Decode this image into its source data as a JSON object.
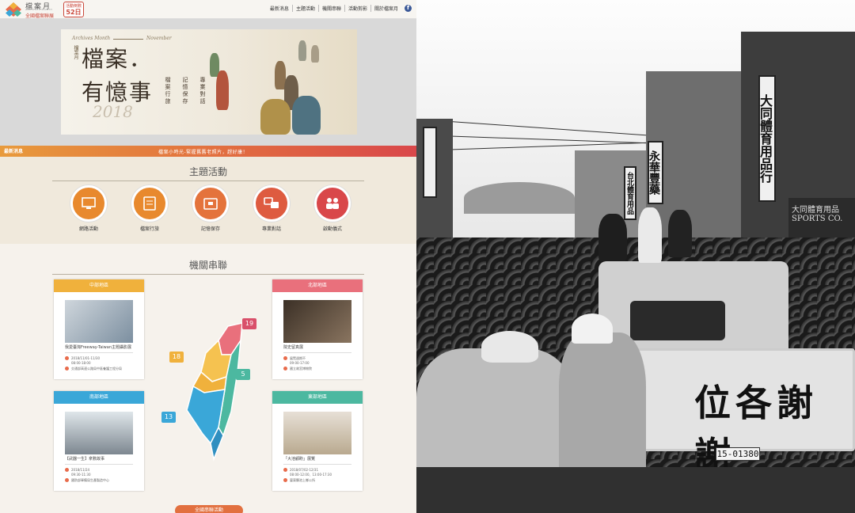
{
  "site": {
    "logo": {
      "name": "檔案月",
      "subtitle": "ARCHIVES MONTH",
      "org": "全國檔案聯展"
    },
    "countdown": {
      "label": "活動倒數",
      "value": "52日"
    },
    "nav": [
      "最新消息",
      "主題活動",
      "機關串聯",
      "活動剪影",
      "關於檔案月"
    ],
    "facebook_glyph": "f",
    "banner": {
      "english_left": "Archives Month",
      "english_right": "November",
      "side_label": "檔案月",
      "title_line1": "檔案．",
      "title_line2": "有憶事",
      "year": "2018",
      "vertical_texts": [
        "專業對話",
        "記憶保存",
        "檔案行旅"
      ],
      "carousel_dots": 4,
      "active_dot": 0
    },
    "news": {
      "label": "最新消息",
      "text": "檔案小時光-緊握舊舊老照片，趕好康！"
    },
    "activities": {
      "title": "主題活動",
      "items": [
        {
          "label": "網路活動",
          "icon": "computer-icon",
          "color": "#e8892e"
        },
        {
          "label": "檔案行旅",
          "icon": "book-icon",
          "color": "#e8892e"
        },
        {
          "label": "記憶保存",
          "icon": "archive-box-icon",
          "color": "#e4733c"
        },
        {
          "label": "專業對話",
          "icon": "chat-icon",
          "color": "#de5b40"
        },
        {
          "label": "啟動儀式",
          "icon": "people-icon",
          "color": "#d9474a"
        }
      ]
    },
    "partners": {
      "title": "機關串聯",
      "map_badges": [
        {
          "value": "19",
          "color": "#d9506a"
        },
        {
          "value": "18",
          "color": "#f0b13c"
        },
        {
          "value": "5",
          "color": "#4cb8a0"
        },
        {
          "value": "13",
          "color": "#3aa7d8"
        }
      ],
      "cards": [
        {
          "region": "中部地區",
          "color": "#f0b13c",
          "caption": "我愛臺灣Freeway-Taiwan主題攝影展",
          "date": "2018/11/01-11/30",
          "time": "08:00-18:00",
          "place": "交通部高速公路局中區養護工程分局"
        },
        {
          "region": "北部地區",
          "color": "#e9707c",
          "caption": "院史留真展",
          "date": "展覽週期不",
          "time": "09:00-17:00",
          "place": "國立故宮博物院"
        },
        {
          "region": "南部地區",
          "color": "#3aa7d8",
          "caption": "【武器一生】拿數故事",
          "date": "2018/11/24",
          "time": "09:30-11:30",
          "place": "國防部軍備局生產製造中心"
        },
        {
          "region": "東部地區",
          "color": "#4cb8a0",
          "caption": "「大池顧盼」展覽",
          "date": "2018/07/02-12/31",
          "time": "08:00-12:00、13:00-17:30",
          "place": "臺東縣池上鄉公所"
        }
      ],
      "all_button": "全國串聯活動"
    }
  },
  "photo": {
    "signs": {
      "store1": "大同體育用品行",
      "store2": "永華豐藥",
      "store3": "台北體育用品",
      "sports_sign": "大同體育用品 SPORTS CO.",
      "car_banner": "位各謝謝",
      "plate": "15-01380"
    }
  }
}
